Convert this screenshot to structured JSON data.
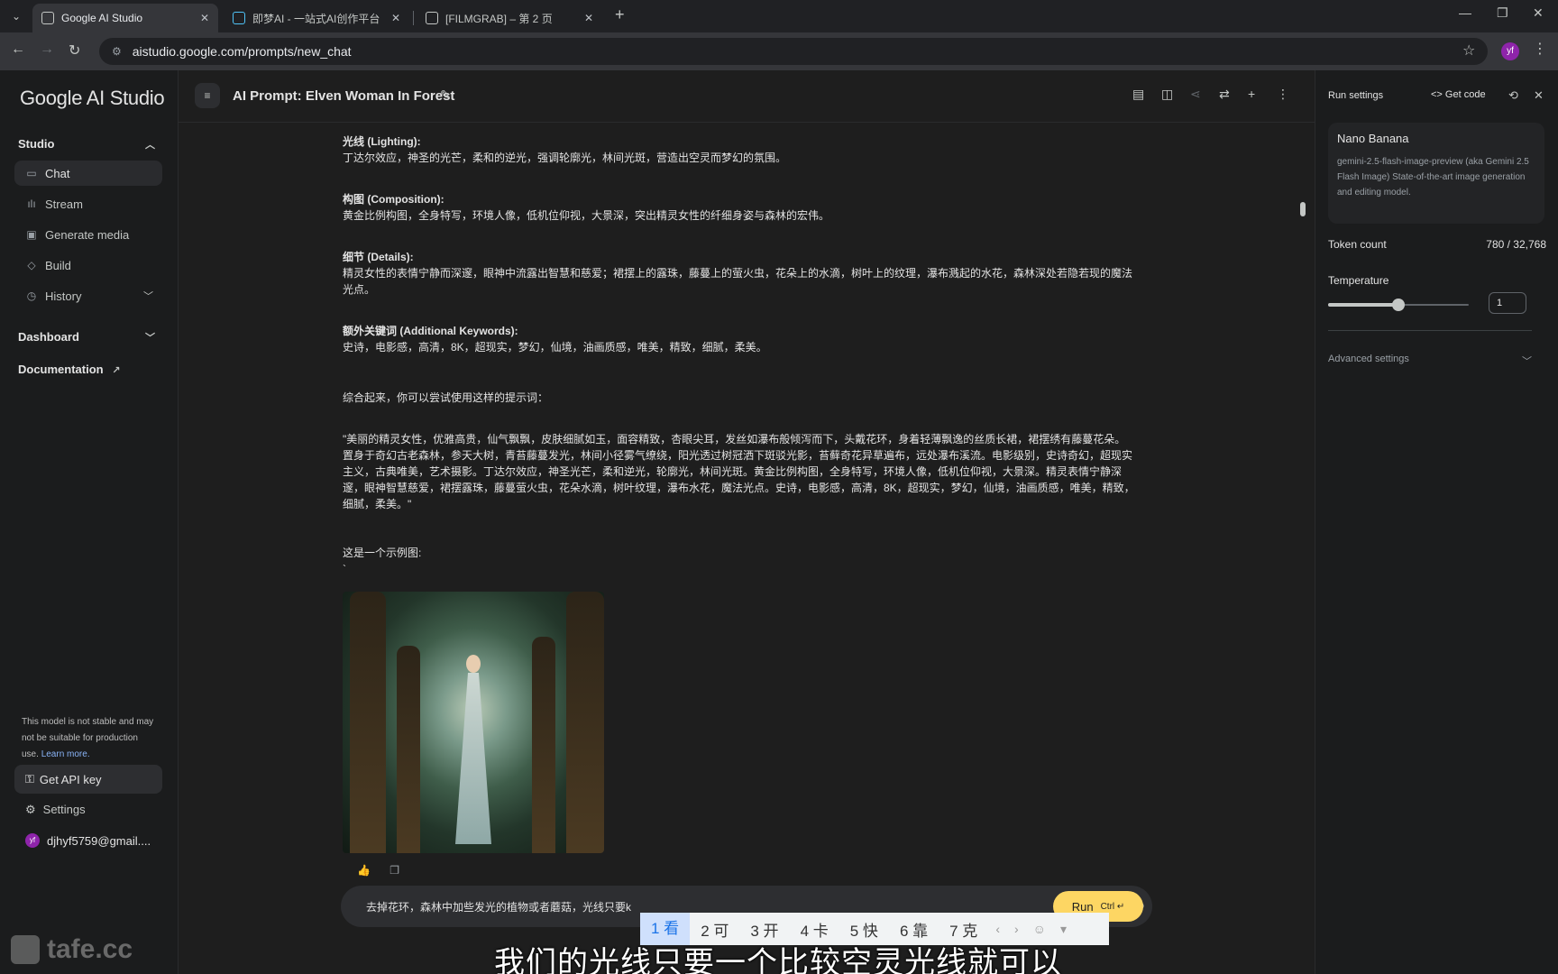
{
  "browser": {
    "tabs": [
      {
        "title": "Google AI Studio",
        "active": true
      },
      {
        "title": "即梦AI - 一站式AI创作平台",
        "active": false
      },
      {
        "title": "[FILMGRAB] – 第 2 页",
        "active": false
      }
    ],
    "url": "aistudio.google.com/prompts/new_chat",
    "profile_initials": "yf"
  },
  "sidebar": {
    "logo": "Google AI Studio",
    "studio_label": "Studio",
    "items": [
      {
        "label": "Chat",
        "icon": "chat-icon"
      },
      {
        "label": "Stream",
        "icon": "stream-icon"
      },
      {
        "label": "Generate media",
        "icon": "media-icon"
      },
      {
        "label": "Build",
        "icon": "build-icon"
      },
      {
        "label": "History",
        "icon": "history-icon"
      }
    ],
    "dashboard_label": "Dashboard",
    "documentation_label": "Documentation",
    "warning_text": "This model is not stable and may not be suitable for production use.",
    "learn_more": "Learn more.",
    "api_key_label": "Get API key",
    "settings_label": "Settings",
    "account_email": "djhyf5759@gmail...."
  },
  "header": {
    "title": "AI Prompt: Elven Woman In Forest"
  },
  "content": {
    "lighting_h": "光线 (Lighting):",
    "lighting": "丁达尔效应，神圣的光芒，柔和的逆光，强调轮廓光，林间光斑，营造出空灵而梦幻的氛围。",
    "composition_h": "构图 (Composition):",
    "composition": "黄金比例构图，全身特写，环境人像，低机位仰视，大景深，突出精灵女性的纤细身姿与森林的宏伟。",
    "details_h": "细节 (Details):",
    "details": "精灵女性的表情宁静而深邃，眼神中流露出智慧和慈爱；裙摆上的露珠，藤蔓上的萤火虫，花朵上的水滴，树叶上的纹理，瀑布溅起的水花，森林深处若隐若现的魔法光点。",
    "keywords_h": "额外关键词 (Additional Keywords):",
    "keywords": "史诗，电影感，高清，8K，超现实，梦幻，仙境，油画质感，唯美，精致，细腻，柔美。",
    "summary": "综合起来，你可以尝试使用这样的提示词：",
    "full_prompt": "\"美丽的精灵女性，优雅高贵，仙气飘飘，皮肤细腻如玉，面容精致，杏眼尖耳，发丝如瀑布般倾泻而下，头戴花环，身着轻薄飘逸的丝质长裙，裙摆绣有藤蔓花朵。置身于奇幻古老森林，参天大树，青苔藤蔓发光，林间小径雾气缭绕，阳光透过树冠洒下斑驳光影，苔藓奇花异草遍布，远处瀑布溪流。电影级别，史诗奇幻，超现实主义，古典唯美，艺术摄影。丁达尔效应，神圣光芒，柔和逆光，轮廓光，林间光斑。黄金比例构图，全身特写，环境人像，低机位仰视，大景深。精灵表情宁静深邃，眼神智慧慈爱，裙摆露珠，藤蔓萤火虫，花朵水滴，树叶纹理，瀑布水花，魔法光点。史诗，电影感，高清，8K，超现实，梦幻，仙境，油画质感，唯美，精致，细腻，柔美。\"",
    "example": "这是一个示例图:",
    "backtick": "`"
  },
  "composer": {
    "text": "去掉花环，森林中加些发光的植物或者蘑菇，光线只要k",
    "run_label": "Run",
    "shortcut": "Ctrl ↵"
  },
  "run_settings": {
    "title": "Run settings",
    "get_code": "Get code",
    "model_name": "Nano Banana",
    "model_desc": "gemini-2.5-flash-image-preview (aka Gemini 2.5 Flash Image) State-of-the-art image generation and editing model.",
    "token_label": "Token count",
    "token_value": "780 / 32,768",
    "temperature_label": "Temperature",
    "temperature_value": "1",
    "temperature_fraction": 0.5,
    "advanced_label": "Advanced settings"
  },
  "ime": {
    "candidates": [
      "1 看",
      "2 可",
      "3 开",
      "4 卡",
      "5 快",
      "6 靠",
      "7 克"
    ]
  },
  "overlay": {
    "subtitle": "我们的光线只要一个比较空灵光线就可以",
    "watermark": "tafe.cc"
  },
  "colors": {
    "run_button": "#fdd663",
    "background": "#1e1e1e",
    "accent_link": "#8ab4f8"
  }
}
